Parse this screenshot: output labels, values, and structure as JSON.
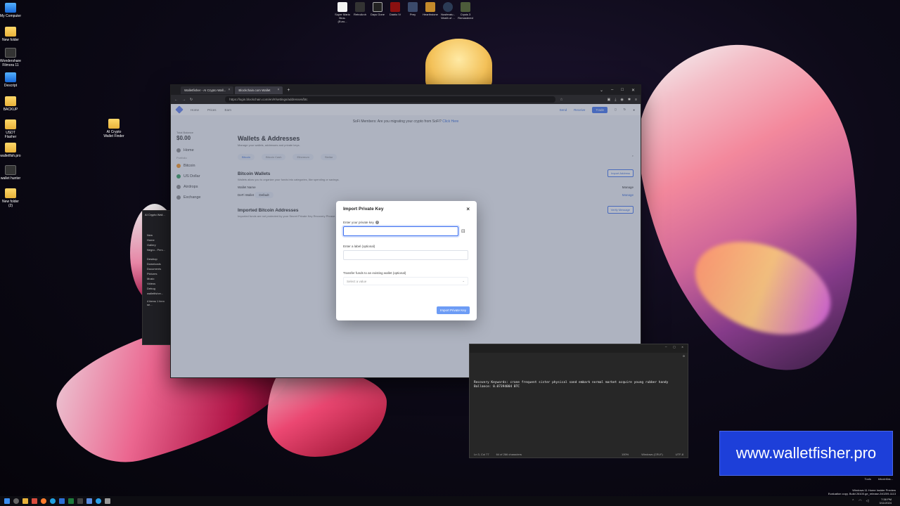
{
  "desktop_icons": [
    {
      "label": "My Computer",
      "type": "app-blue"
    },
    {
      "label": "New folder",
      "type": "folder"
    },
    {
      "label": "Wondershare Filmora 11",
      "type": "app-dark"
    },
    {
      "label": "Descript",
      "type": "app-blue"
    },
    {
      "label": "BACKUP",
      "type": "folder"
    },
    {
      "label": "USDT Flasher",
      "type": "folder"
    },
    {
      "label": "walletfish.pro",
      "type": "folder"
    },
    {
      "label": "wallet hunter",
      "type": "app-dark"
    },
    {
      "label": "New folder (2)",
      "type": "folder"
    },
    {
      "label": "AI Crypto Wallet Finder",
      "type": "folder"
    }
  ],
  "top_shortcuts": [
    {
      "label": "Super Mario Bros. (Euro...",
      "color": "#f2f2f2"
    },
    {
      "label": "RetroArch",
      "color": "#333333"
    },
    {
      "label": "Days Gone",
      "color": "#222222"
    },
    {
      "label": "Diablo IV",
      "color": "#8b1010"
    },
    {
      "label": "Prey",
      "color": "#3b4a6b"
    },
    {
      "label": "Hearthstone",
      "color": "#c48a2b"
    },
    {
      "label": "Nosferatu - Wrath of ...",
      "color": "#2b3b55"
    },
    {
      "label": "Crysis 3 Remastered",
      "color": "#4c5b3a"
    }
  ],
  "browser": {
    "tabs": [
      {
        "label": "Walletfisher - AI Crypto Wall...",
        "active": false
      },
      {
        "label": "Blockchain.com Wallet",
        "active": true
      }
    ],
    "new_tab": "+",
    "url": "https://login.blockchain.com/en/#/settings/addresses/btc"
  },
  "page": {
    "nav": [
      "Home",
      "Prices",
      "Earn"
    ],
    "nav_right": {
      "send": "Send",
      "receive": "Receive",
      "trade": "Trade"
    },
    "banner_text": "SoFi Members: Are you migrating your crypto from SoFi?",
    "banner_link": "Click Here",
    "sidebar": {
      "balance_label": "Total Balance",
      "balance": "$0.00",
      "items": [
        "Home",
        "Portfolio",
        "Bitcoin",
        "US Dollar",
        "Airdrops",
        "Exchange"
      ]
    },
    "title": "Wallets & Addresses",
    "subtitle": "Manage your wallets, addresses and private keys.",
    "chips": [
      "Bitcoin",
      "Bitcoin Cash",
      "Ethereum",
      "Stellar"
    ],
    "wallets_heading": "Bitcoin Wallets",
    "wallets_sub": "Wallets allow you to organize your funds into categories, like spending or savings.",
    "import_address": "Import Address",
    "wallet_name_col": "Wallet Name",
    "manage_col": "Manage",
    "wallet_row": "DeFi Wallet",
    "default_badge": "Default",
    "manage_link": "Manage",
    "imported_heading": "Imported Bitcoin Addresses",
    "imported_sub": "Imported funds are not protected by your Secret Private Key Recovery Phrase.",
    "verify_message": "Verify Message"
  },
  "modal": {
    "title": "Import Private Key",
    "close": "×",
    "key_label": "Enter your private key",
    "key_value": "",
    "label_label": "Enter a label (optional)",
    "label_value": "",
    "transfer_label": "Transfer funds to an existing wallet (optional)",
    "select_placeholder": "Select a value",
    "submit": "Import Private Key"
  },
  "explorer": {
    "title": "AI Crypto Wall...",
    "new": "New",
    "items": [
      "Home",
      "Gallery",
      "Negru - Pers...",
      "Desktop",
      "Downloads",
      "Documents",
      "Pictures",
      "Music",
      "Videos",
      "Debug",
      "walletfisher..."
    ],
    "status": "4 items   1 item se..."
  },
  "notepad": {
    "line1": "Recovery Keywords: crane frequent sister physical sand embark normal market acquire young rubber handy",
    "line2": "Ballance: 0.07394004 BTC",
    "status_pos": "Ln 3, Col 77",
    "status_chars": "64 of 266 characters",
    "zoom": "100%",
    "eol": "Windows (CRLF)",
    "encoding": "UTF-8"
  },
  "watermark": "www.walletfisher.pro",
  "tools": [
    "Tools",
    "bitcoinflas..."
  ],
  "eval_line1": "Windows 11 Home Insider Preview",
  "eval_line2": "Evaluation copy. Build 26100.ge_release.240209-1113",
  "clock_time": "7:38 PM",
  "clock_date": "3/11/2024"
}
